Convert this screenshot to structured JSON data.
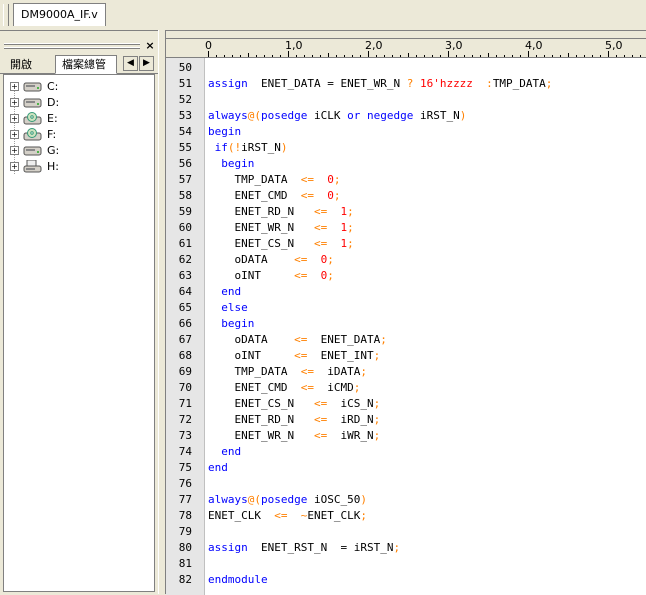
{
  "tab": {
    "file_name": "DM9000A_IF.v"
  },
  "panel": {
    "close_glyph": "×",
    "tabs": [
      {
        "label": "開啟"
      },
      {
        "label": "檔案總管"
      }
    ],
    "arrows": {
      "left": "◀",
      "right": "▶"
    },
    "drives": [
      {
        "label": "C:",
        "icon": "hard-drive-icon"
      },
      {
        "label": "D:",
        "icon": "hard-drive-icon"
      },
      {
        "label": "E:",
        "icon": "cd-drive-icon"
      },
      {
        "label": "F:",
        "icon": "cd-drive-icon"
      },
      {
        "label": "G:",
        "icon": "hard-drive-icon"
      },
      {
        "label": "H:",
        "icon": "removable-drive-icon"
      }
    ]
  },
  "ruler": {
    "labels": [
      "0",
      "1,0",
      "2,0",
      "3,0",
      "4,0",
      "5,0"
    ]
  },
  "code": {
    "lines": [
      {
        "no": "50",
        "segs": []
      },
      {
        "no": "51",
        "segs": [
          [
            "kw",
            "assign"
          ],
          [
            "",
            "  ENET_DATA = ENET_WR_N "
          ],
          [
            "op",
            "?"
          ],
          [
            "",
            ""
          ],
          [
            "num",
            " 16'hzzzz"
          ],
          [
            "",
            ""
          ],
          [
            "op",
            "  :"
          ],
          [
            "",
            ""
          ],
          [
            "",
            "TMP_DATA"
          ],
          [
            "op",
            ";"
          ]
        ]
      },
      {
        "no": "52",
        "segs": []
      },
      {
        "no": "53",
        "segs": [
          [
            "kw",
            "always"
          ],
          [
            "op",
            "@("
          ],
          [
            "kw",
            "posedge"
          ],
          [
            "",
            " iCLK "
          ],
          [
            "kw",
            "or"
          ],
          [
            "",
            " "
          ],
          [
            "kw",
            "negedge"
          ],
          [
            "",
            " iRST_N"
          ],
          [
            "op",
            ")"
          ]
        ]
      },
      {
        "no": "54",
        "segs": [
          [
            "kw",
            "begin"
          ]
        ]
      },
      {
        "no": "55",
        "segs": [
          [
            "",
            " "
          ],
          [
            "kw",
            "if"
          ],
          [
            "op",
            "(!"
          ],
          [
            "",
            "iRST_N"
          ],
          [
            "op",
            ")"
          ]
        ]
      },
      {
        "no": "56",
        "segs": [
          [
            "",
            "  "
          ],
          [
            "kw",
            "begin"
          ]
        ]
      },
      {
        "no": "57",
        "segs": [
          [
            "",
            "    TMP_DATA  "
          ],
          [
            "op",
            "<="
          ],
          [
            "",
            "  "
          ],
          [
            "num",
            "0"
          ],
          [
            "op",
            ";"
          ]
        ]
      },
      {
        "no": "58",
        "segs": [
          [
            "",
            "    ENET_CMD  "
          ],
          [
            "op",
            "<="
          ],
          [
            "",
            "  "
          ],
          [
            "num",
            "0"
          ],
          [
            "op",
            ";"
          ]
        ]
      },
      {
        "no": "59",
        "segs": [
          [
            "",
            "    ENET_RD_N   "
          ],
          [
            "op",
            "<="
          ],
          [
            "",
            "  "
          ],
          [
            "num",
            "1"
          ],
          [
            "op",
            ";"
          ]
        ]
      },
      {
        "no": "60",
        "segs": [
          [
            "",
            "    ENET_WR_N   "
          ],
          [
            "op",
            "<="
          ],
          [
            "",
            "  "
          ],
          [
            "num",
            "1"
          ],
          [
            "op",
            ";"
          ]
        ]
      },
      {
        "no": "61",
        "segs": [
          [
            "",
            "    ENET_CS_N   "
          ],
          [
            "op",
            "<="
          ],
          [
            "",
            "  "
          ],
          [
            "num",
            "1"
          ],
          [
            "op",
            ";"
          ]
        ]
      },
      {
        "no": "62",
        "segs": [
          [
            "",
            "    oDATA    "
          ],
          [
            "op",
            "<="
          ],
          [
            "",
            "  "
          ],
          [
            "num",
            "0"
          ],
          [
            "op",
            ";"
          ]
        ]
      },
      {
        "no": "63",
        "segs": [
          [
            "",
            "    oINT     "
          ],
          [
            "op",
            "<="
          ],
          [
            "",
            "  "
          ],
          [
            "num",
            "0"
          ],
          [
            "op",
            ";"
          ]
        ]
      },
      {
        "no": "64",
        "segs": [
          [
            "",
            "  "
          ],
          [
            "kw",
            "end"
          ]
        ]
      },
      {
        "no": "65",
        "segs": [
          [
            "",
            "  "
          ],
          [
            "kw",
            "else"
          ]
        ]
      },
      {
        "no": "66",
        "segs": [
          [
            "",
            "  "
          ],
          [
            "kw",
            "begin"
          ]
        ]
      },
      {
        "no": "67",
        "segs": [
          [
            "",
            "    oDATA    "
          ],
          [
            "op",
            "<="
          ],
          [
            "",
            "  ENET_DATA"
          ],
          [
            "op",
            ";"
          ]
        ]
      },
      {
        "no": "68",
        "segs": [
          [
            "",
            "    oINT     "
          ],
          [
            "op",
            "<="
          ],
          [
            "",
            "  ENET_INT"
          ],
          [
            "op",
            ";"
          ]
        ]
      },
      {
        "no": "69",
        "segs": [
          [
            "",
            "    TMP_DATA  "
          ],
          [
            "op",
            "<="
          ],
          [
            "",
            "  iDATA"
          ],
          [
            "op",
            ";"
          ]
        ]
      },
      {
        "no": "70",
        "segs": [
          [
            "",
            "    ENET_CMD  "
          ],
          [
            "op",
            "<="
          ],
          [
            "",
            "  iCMD"
          ],
          [
            "op",
            ";"
          ]
        ]
      },
      {
        "no": "71",
        "segs": [
          [
            "",
            "    ENET_CS_N   "
          ],
          [
            "op",
            "<="
          ],
          [
            "",
            "  iCS_N"
          ],
          [
            "op",
            ";"
          ]
        ]
      },
      {
        "no": "72",
        "segs": [
          [
            "",
            "    ENET_RD_N   "
          ],
          [
            "op",
            "<="
          ],
          [
            "",
            "  iRD_N"
          ],
          [
            "op",
            ";"
          ]
        ]
      },
      {
        "no": "73",
        "segs": [
          [
            "",
            "    ENET_WR_N   "
          ],
          [
            "op",
            "<="
          ],
          [
            "",
            "  iWR_N"
          ],
          [
            "op",
            ";"
          ]
        ]
      },
      {
        "no": "74",
        "segs": [
          [
            "",
            "  "
          ],
          [
            "kw",
            "end"
          ]
        ]
      },
      {
        "no": "75",
        "segs": [
          [
            "kw",
            "end"
          ]
        ]
      },
      {
        "no": "76",
        "segs": []
      },
      {
        "no": "77",
        "segs": [
          [
            "kw",
            "always"
          ],
          [
            "op",
            "@("
          ],
          [
            "kw",
            "posedge"
          ],
          [
            "",
            " iOSC_50"
          ],
          [
            "op",
            ")"
          ]
        ]
      },
      {
        "no": "78",
        "segs": [
          [
            "",
            "ENET_CLK  "
          ],
          [
            "op",
            "<="
          ],
          [
            "",
            "  "
          ],
          [
            "op",
            "~"
          ],
          [
            "",
            "ENET_CLK"
          ],
          [
            "op",
            ";"
          ]
        ]
      },
      {
        "no": "79",
        "segs": []
      },
      {
        "no": "80",
        "segs": [
          [
            "kw",
            "assign"
          ],
          [
            "",
            "  ENET_RST_N  = iRST_N"
          ],
          [
            "op",
            ";"
          ]
        ]
      },
      {
        "no": "81",
        "segs": []
      },
      {
        "no": "82",
        "segs": [
          [
            "kw",
            "endmodule"
          ]
        ]
      }
    ]
  },
  "colors": {
    "keyword": "#0000ff",
    "number": "#ff0000",
    "operator": "#ff8000"
  }
}
